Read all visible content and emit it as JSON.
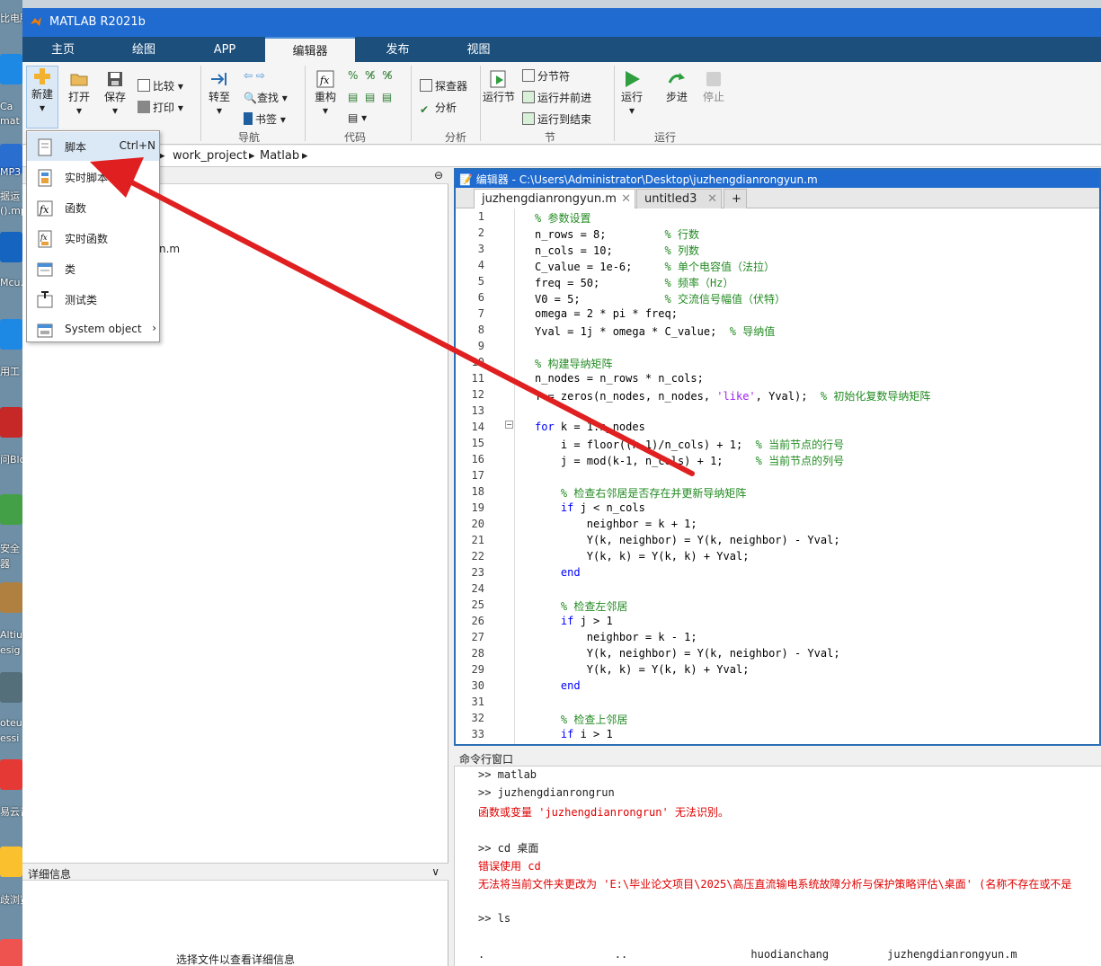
{
  "window": {
    "title": "MATLAB R2021b"
  },
  "desktop": {
    "labels": [
      "比电脑",
      "Ca",
      "mat",
      "MP3",
      "据运",
      "().mp",
      "Mcu.",
      "用工",
      "问Blo",
      "安全",
      "器",
      "Altiur",
      "esig",
      "oteu",
      "essi",
      "易云音",
      "歧浏览"
    ]
  },
  "tabs": [
    {
      "label": "主页"
    },
    {
      "label": "绘图"
    },
    {
      "label": "APP"
    },
    {
      "label": "编辑器"
    },
    {
      "label": "发布"
    },
    {
      "label": "视图"
    }
  ],
  "ribbon": {
    "new": "新建",
    "open": "打开",
    "save": "保存",
    "compare": "比较",
    "print": "打印",
    "goto": "转至",
    "find": "查找",
    "bookmark": "书签",
    "nav_group": "导航",
    "refactor": "重构",
    "code_group": "代码",
    "profiler": "探查器",
    "analyze": "分析",
    "analyze_group": "分析",
    "run_section": "运行节",
    "section_break": "分节符",
    "run_advance": "运行并前进",
    "run_to_end": "运行到结束",
    "section_group": "节",
    "run": "运行",
    "step": "步进",
    "stop": "停止",
    "run_group": "运行"
  },
  "breadcrumb": [
    "work_project",
    "Matlab"
  ],
  "left_pane": {
    "file_fragment": "n.m",
    "details_title": "详细信息",
    "details_hint": "选择文件以查看详细信息"
  },
  "new_menu": [
    {
      "label": "脚本",
      "shortcut": "Ctrl+N",
      "icon": "script-icon"
    },
    {
      "label": "实时脚本",
      "shortcut": "",
      "icon": "live-script-icon"
    },
    {
      "label": "函数",
      "shortcut": "",
      "icon": "function-icon"
    },
    {
      "label": "实时函数",
      "shortcut": "",
      "icon": "live-function-icon"
    },
    {
      "label": "类",
      "shortcut": "",
      "icon": "class-icon"
    },
    {
      "label": "测试类",
      "shortcut": "",
      "icon": "test-class-icon"
    },
    {
      "label": "System object",
      "shortcut": "",
      "icon": "system-object-icon"
    }
  ],
  "editor": {
    "title": "编辑器 - C:\\Users\\Administrator\\Desktop\\juzhengdianrongyun.m",
    "tabs": [
      "juzhengdianrongyun.m",
      "untitled3"
    ],
    "add_tab": "+",
    "lines": [
      [
        [
          "cmt",
          "% 参数设置"
        ]
      ],
      [
        [
          "",
          "n_rows = 8;         "
        ],
        [
          "cmt",
          "% 行数"
        ]
      ],
      [
        [
          "",
          "n_cols = 10;        "
        ],
        [
          "cmt",
          "% 列数"
        ]
      ],
      [
        [
          "",
          "C_value = 1e-6;     "
        ],
        [
          "cmt",
          "% 单个电容值（法拉）"
        ]
      ],
      [
        [
          "",
          "freq = 50;          "
        ],
        [
          "cmt",
          "% 频率（Hz）"
        ]
      ],
      [
        [
          "",
          "V0 = 5;             "
        ],
        [
          "cmt",
          "% 交流信号幅值（伏特）"
        ]
      ],
      [
        [
          "",
          "omega = 2 * pi * freq;"
        ]
      ],
      [
        [
          "",
          "Yval = 1j * omega * C_value;  "
        ],
        [
          "cmt",
          "% 导纳值"
        ]
      ],
      [
        [
          "",
          ""
        ]
      ],
      [
        [
          "cmt",
          "% 构建导纳矩阵"
        ]
      ],
      [
        [
          "",
          "n_nodes = n_rows * n_cols;"
        ]
      ],
      [
        [
          "",
          "Y = zeros(n_nodes, n_nodes, "
        ],
        [
          "str",
          "'like'"
        ],
        [
          "",
          ", Yval);  "
        ],
        [
          "cmt",
          "% 初始化复数导纳矩阵"
        ]
      ],
      [
        [
          "",
          ""
        ]
      ],
      [
        [
          "kw",
          "for"
        ],
        [
          "",
          " k = 1:n_nodes"
        ]
      ],
      [
        [
          "",
          "    i = floor((k-1)/n_cols) + 1;  "
        ],
        [
          "cmt",
          "% 当前节点的行号"
        ]
      ],
      [
        [
          "",
          "    j = mod(k-1, n_cols) + 1;     "
        ],
        [
          "cmt",
          "% 当前节点的列号"
        ]
      ],
      [
        [
          "",
          ""
        ]
      ],
      [
        [
          "cmt",
          "    % 检查右邻居是否存在并更新导纳矩阵"
        ]
      ],
      [
        [
          "kw",
          "    if"
        ],
        [
          "",
          " j < n_cols"
        ]
      ],
      [
        [
          "",
          "        neighbor = k + 1;"
        ]
      ],
      [
        [
          "",
          "        Y(k, neighbor) = Y(k, neighbor) - Yval;"
        ]
      ],
      [
        [
          "",
          "        Y(k, k) = Y(k, k) + Yval;"
        ]
      ],
      [
        [
          "kw",
          "    end"
        ]
      ],
      [
        [
          "",
          ""
        ]
      ],
      [
        [
          "cmt",
          "    % 检查左邻居"
        ]
      ],
      [
        [
          "kw",
          "    if"
        ],
        [
          "",
          " j > 1"
        ]
      ],
      [
        [
          "",
          "        neighbor = k - 1;"
        ]
      ],
      [
        [
          "",
          "        Y(k, neighbor) = Y(k, neighbor) - Yval;"
        ]
      ],
      [
        [
          "",
          "        Y(k, k) = Y(k, k) + Yval;"
        ]
      ],
      [
        [
          "kw",
          "    end"
        ]
      ],
      [
        [
          "",
          ""
        ]
      ],
      [
        [
          "cmt",
          "    % 检查上邻居"
        ]
      ],
      [
        [
          "kw",
          "    if"
        ],
        [
          "",
          " i > 1"
        ]
      ]
    ]
  },
  "command": {
    "title": "命令行窗口",
    "lines": [
      {
        "t": ">> matlab",
        "c": ""
      },
      {
        "t": ">> juzhengdianrongrun",
        "c": ""
      },
      {
        "t": "函数或变量 'juzhengdianrongrun' 无法识别。",
        "c": "err"
      },
      {
        "t": "",
        "c": ""
      },
      {
        "t": ">> cd 桌面",
        "c": ""
      },
      {
        "t": "错误使用 cd",
        "c": "err"
      },
      {
        "t": "无法将当前文件夹更改为 'E:\\毕业论文项目\\2025\\高压直流输电系统故障分析与保护策略评估\\桌面' (名称不存在或不是",
        "c": "err"
      },
      {
        "t": "",
        "c": ""
      },
      {
        "t": ">> ls",
        "c": ""
      },
      {
        "t": "",
        "c": ""
      },
      {
        "t": ".                    ..                   huodianchang         juzhengdianrongyun.m",
        "c": ""
      }
    ]
  },
  "colors": {
    "title_bar": "#1f6bd0",
    "tab_bar": "#1c4f7c",
    "arrow": "#e02020",
    "comment": "#228b22",
    "keyword": "#0000ff",
    "string": "#a020f0",
    "error": "#e00000"
  }
}
